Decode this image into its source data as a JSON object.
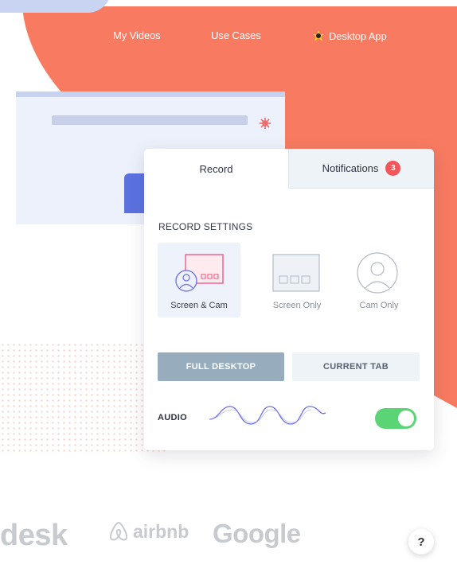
{
  "nav": {
    "my_videos": "My Videos",
    "use_cases": "Use Cases",
    "desktop_app": "Desktop App",
    "desktop_icon": "sparkle-bug-icon"
  },
  "panel": {
    "tabs": {
      "record": "Record",
      "notifications": "Notifications",
      "notification_count": "3"
    },
    "section_title": "RECORD SETTINGS",
    "options": {
      "screen_cam": "Screen & Cam",
      "screen_only": "Screen Only",
      "cam_only": "Cam Only",
      "selected": "Screen & Cam"
    },
    "area": {
      "full_desktop": "FULL DESKTOP",
      "current_tab": "CURRENT TAB",
      "selected": "FULL DESKTOP"
    },
    "audio": {
      "label": "AUDIO",
      "enabled": true
    }
  },
  "logos": {
    "desk": "desk",
    "airbnb": "airbnb",
    "google": "Google"
  },
  "help": {
    "label": "?"
  },
  "colors": {
    "coral": "#f87a61",
    "toggle_on": "#5bd476",
    "badge": "#f2555a",
    "selected_button": "#97adbd",
    "accent_pink": "#f24f7d"
  }
}
